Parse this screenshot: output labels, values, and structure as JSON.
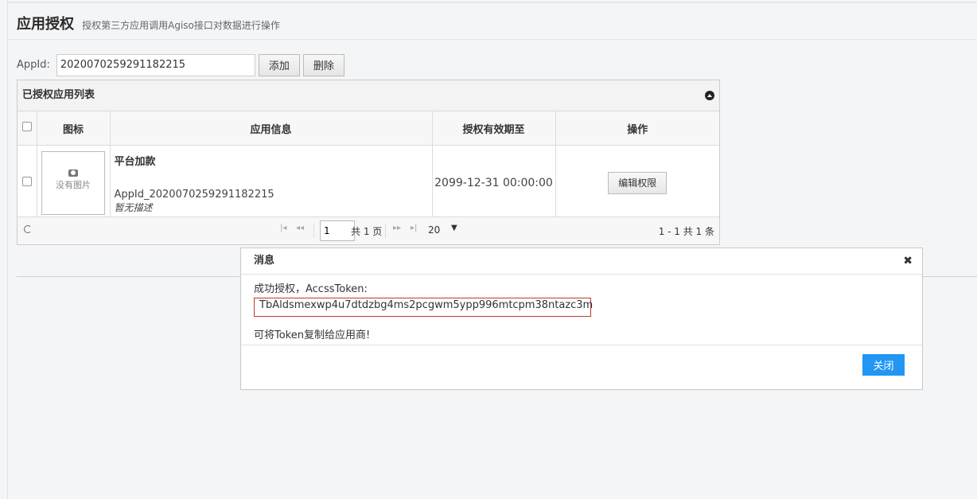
{
  "header": {
    "title": "应用授权",
    "subtitle": "授权第三方应用调用Agiso接口对数据进行操作"
  },
  "appid_form": {
    "label": "AppId:",
    "value": "2020070259291182215",
    "add_label": "添加",
    "delete_label": "删除"
  },
  "panel": {
    "title": "已授权应用列表",
    "columns": [
      "图标",
      "应用信息",
      "授权有效期至",
      "操作"
    ],
    "rows": [
      {
        "image_placeholder": "没有图片",
        "app_name": "平台加款",
        "app_id": "AppId_2020070259291182215",
        "description": "暂无描述",
        "expire": "2099-12-31 00:00:00",
        "action_label": "编辑权限"
      }
    ]
  },
  "pager": {
    "page": "1",
    "total_pages": "共 1 页",
    "page_size": "20",
    "range": "1 - 1  共 1 条"
  },
  "dialog": {
    "title": "消息",
    "line1": "成功授权，AccssToken:",
    "token": "TbAldsmexwp4u7dtdzbg4ms2pcgwm5ypp996mtcpm38ntazc3m",
    "line2": "可将Token复制给应用商!",
    "close_label": "关闭"
  },
  "colors": {
    "primary_button": "#2196f3",
    "token_border": "#c0392b"
  }
}
